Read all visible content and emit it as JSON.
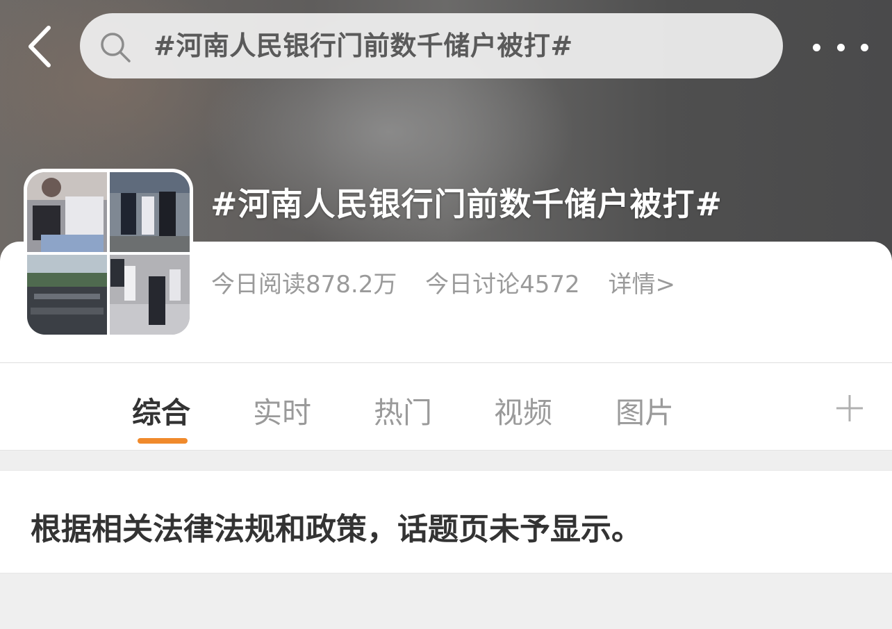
{
  "header": {
    "search_text": "#河南人民银行门前数千储户被打#"
  },
  "topic": {
    "title": "#河南人民银行门前数千储户被打#",
    "reads_label": "今日阅读878.2万",
    "discussions_label": "今日讨论4572",
    "details_label": "详情>"
  },
  "tabs": [
    {
      "label": "综合",
      "active": true
    },
    {
      "label": "实时",
      "active": false
    },
    {
      "label": "热门",
      "active": false
    },
    {
      "label": "视频",
      "active": false
    },
    {
      "label": "图片",
      "active": false
    }
  ],
  "notice": {
    "text": "根据相关法律法规和政策，话题页未予显示。"
  },
  "colors": {
    "accent": "#f08a2c",
    "active_tab": "#333333",
    "inactive_tab": "#9a9a9a"
  }
}
